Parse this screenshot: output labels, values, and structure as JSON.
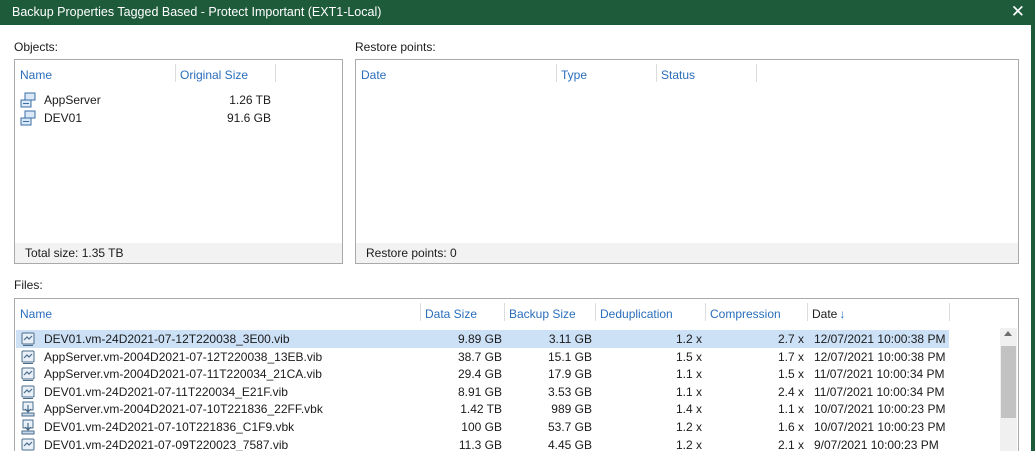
{
  "window": {
    "title": "Backup Properties Tagged Based - Protect Important (EXT1-Local)",
    "close_glyph": "✕"
  },
  "objects": {
    "label": "Objects:",
    "columns": {
      "name": "Name",
      "original_size": "Original Size"
    },
    "rows": [
      {
        "name": "AppServer",
        "size": "1.26 TB",
        "icon": "vm-icon"
      },
      {
        "name": "DEV01",
        "size": "91.6 GB",
        "icon": "vm-icon"
      }
    ],
    "footer": "Total size: 1.35 TB"
  },
  "restore_points": {
    "label": "Restore points:",
    "columns": {
      "date": "Date",
      "type": "Type",
      "status": "Status"
    },
    "footer": "Restore points: 0"
  },
  "files": {
    "label": "Files:",
    "columns": {
      "name": "Name",
      "data_size": "Data Size",
      "backup_size": "Backup Size",
      "deduplication": "Deduplication",
      "compression": "Compression",
      "date": "Date",
      "date_sort_glyph": "↓"
    },
    "rows": [
      {
        "name": "DEV01.vm-24D2021-07-12T220038_3E00.vib",
        "data_size": "9.89 GB",
        "backup_size": "3.11 GB",
        "dedup": "1.2 x",
        "compression": "2.7 x",
        "date": "12/07/2021 10:00:38 PM",
        "icon": "incremental-file-icon",
        "selected": true
      },
      {
        "name": "AppServer.vm-2004D2021-07-12T220038_13EB.vib",
        "data_size": "38.7 GB",
        "backup_size": "15.1 GB",
        "dedup": "1.5 x",
        "compression": "1.7 x",
        "date": "12/07/2021 10:00:38 PM",
        "icon": "incremental-file-icon",
        "selected": false
      },
      {
        "name": "AppServer.vm-2004D2021-07-11T220034_21CA.vib",
        "data_size": "29.4 GB",
        "backup_size": "17.9 GB",
        "dedup": "1.1 x",
        "compression": "1.5 x",
        "date": "11/07/2021 10:00:34 PM",
        "icon": "incremental-file-icon",
        "selected": false
      },
      {
        "name": "DEV01.vm-24D2021-07-11T220034_E21F.vib",
        "data_size": "8.91 GB",
        "backup_size": "3.53 GB",
        "dedup": "1.1 x",
        "compression": "2.4 x",
        "date": "11/07/2021 10:00:34 PM",
        "icon": "incremental-file-icon",
        "selected": false
      },
      {
        "name": "AppServer.vm-2004D2021-07-10T221836_22FF.vbk",
        "data_size": "1.42 TB",
        "backup_size": "989 GB",
        "dedup": "1.4 x",
        "compression": "1.1 x",
        "date": "10/07/2021 10:00:23 PM",
        "icon": "full-file-icon",
        "selected": false
      },
      {
        "name": "DEV01.vm-24D2021-07-10T221836_C1F9.vbk",
        "data_size": "100 GB",
        "backup_size": "53.7 GB",
        "dedup": "1.2 x",
        "compression": "1.6 x",
        "date": "10/07/2021 10:00:23 PM",
        "icon": "full-file-icon",
        "selected": false
      },
      {
        "name": "DEV01.vm-24D2021-07-09T220023_7587.vib",
        "data_size": "11.3 GB",
        "backup_size": "4.45 GB",
        "dedup": "1.2 x",
        "compression": "2.1 x",
        "date": "9/07/2021 10:00:23 PM",
        "icon": "incremental-file-icon",
        "selected": false
      }
    ]
  },
  "colors": {
    "titlebar": "#1e5b3a",
    "header_text": "#2a6ebb",
    "selection": "#cce0f6"
  }
}
